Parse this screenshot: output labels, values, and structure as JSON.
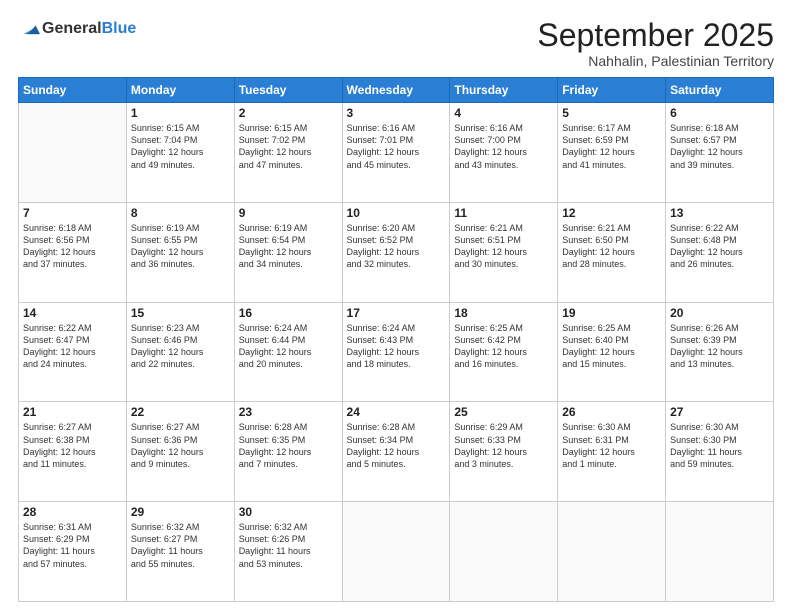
{
  "logo": {
    "general": "General",
    "blue": "Blue"
  },
  "header": {
    "month": "September 2025",
    "location": "Nahhalin, Palestinian Territory"
  },
  "weekdays": [
    "Sunday",
    "Monday",
    "Tuesday",
    "Wednesday",
    "Thursday",
    "Friday",
    "Saturday"
  ],
  "weeks": [
    [
      {
        "day": "",
        "content": ""
      },
      {
        "day": "1",
        "content": "Sunrise: 6:15 AM\nSunset: 7:04 PM\nDaylight: 12 hours\nand 49 minutes."
      },
      {
        "day": "2",
        "content": "Sunrise: 6:15 AM\nSunset: 7:02 PM\nDaylight: 12 hours\nand 47 minutes."
      },
      {
        "day": "3",
        "content": "Sunrise: 6:16 AM\nSunset: 7:01 PM\nDaylight: 12 hours\nand 45 minutes."
      },
      {
        "day": "4",
        "content": "Sunrise: 6:16 AM\nSunset: 7:00 PM\nDaylight: 12 hours\nand 43 minutes."
      },
      {
        "day": "5",
        "content": "Sunrise: 6:17 AM\nSunset: 6:59 PM\nDaylight: 12 hours\nand 41 minutes."
      },
      {
        "day": "6",
        "content": "Sunrise: 6:18 AM\nSunset: 6:57 PM\nDaylight: 12 hours\nand 39 minutes."
      }
    ],
    [
      {
        "day": "7",
        "content": "Sunrise: 6:18 AM\nSunset: 6:56 PM\nDaylight: 12 hours\nand 37 minutes."
      },
      {
        "day": "8",
        "content": "Sunrise: 6:19 AM\nSunset: 6:55 PM\nDaylight: 12 hours\nand 36 minutes."
      },
      {
        "day": "9",
        "content": "Sunrise: 6:19 AM\nSunset: 6:54 PM\nDaylight: 12 hours\nand 34 minutes."
      },
      {
        "day": "10",
        "content": "Sunrise: 6:20 AM\nSunset: 6:52 PM\nDaylight: 12 hours\nand 32 minutes."
      },
      {
        "day": "11",
        "content": "Sunrise: 6:21 AM\nSunset: 6:51 PM\nDaylight: 12 hours\nand 30 minutes."
      },
      {
        "day": "12",
        "content": "Sunrise: 6:21 AM\nSunset: 6:50 PM\nDaylight: 12 hours\nand 28 minutes."
      },
      {
        "day": "13",
        "content": "Sunrise: 6:22 AM\nSunset: 6:48 PM\nDaylight: 12 hours\nand 26 minutes."
      }
    ],
    [
      {
        "day": "14",
        "content": "Sunrise: 6:22 AM\nSunset: 6:47 PM\nDaylight: 12 hours\nand 24 minutes."
      },
      {
        "day": "15",
        "content": "Sunrise: 6:23 AM\nSunset: 6:46 PM\nDaylight: 12 hours\nand 22 minutes."
      },
      {
        "day": "16",
        "content": "Sunrise: 6:24 AM\nSunset: 6:44 PM\nDaylight: 12 hours\nand 20 minutes."
      },
      {
        "day": "17",
        "content": "Sunrise: 6:24 AM\nSunset: 6:43 PM\nDaylight: 12 hours\nand 18 minutes."
      },
      {
        "day": "18",
        "content": "Sunrise: 6:25 AM\nSunset: 6:42 PM\nDaylight: 12 hours\nand 16 minutes."
      },
      {
        "day": "19",
        "content": "Sunrise: 6:25 AM\nSunset: 6:40 PM\nDaylight: 12 hours\nand 15 minutes."
      },
      {
        "day": "20",
        "content": "Sunrise: 6:26 AM\nSunset: 6:39 PM\nDaylight: 12 hours\nand 13 minutes."
      }
    ],
    [
      {
        "day": "21",
        "content": "Sunrise: 6:27 AM\nSunset: 6:38 PM\nDaylight: 12 hours\nand 11 minutes."
      },
      {
        "day": "22",
        "content": "Sunrise: 6:27 AM\nSunset: 6:36 PM\nDaylight: 12 hours\nand 9 minutes."
      },
      {
        "day": "23",
        "content": "Sunrise: 6:28 AM\nSunset: 6:35 PM\nDaylight: 12 hours\nand 7 minutes."
      },
      {
        "day": "24",
        "content": "Sunrise: 6:28 AM\nSunset: 6:34 PM\nDaylight: 12 hours\nand 5 minutes."
      },
      {
        "day": "25",
        "content": "Sunrise: 6:29 AM\nSunset: 6:33 PM\nDaylight: 12 hours\nand 3 minutes."
      },
      {
        "day": "26",
        "content": "Sunrise: 6:30 AM\nSunset: 6:31 PM\nDaylight: 12 hours\nand 1 minute."
      },
      {
        "day": "27",
        "content": "Sunrise: 6:30 AM\nSunset: 6:30 PM\nDaylight: 11 hours\nand 59 minutes."
      }
    ],
    [
      {
        "day": "28",
        "content": "Sunrise: 6:31 AM\nSunset: 6:29 PM\nDaylight: 11 hours\nand 57 minutes."
      },
      {
        "day": "29",
        "content": "Sunrise: 6:32 AM\nSunset: 6:27 PM\nDaylight: 11 hours\nand 55 minutes."
      },
      {
        "day": "30",
        "content": "Sunrise: 6:32 AM\nSunset: 6:26 PM\nDaylight: 11 hours\nand 53 minutes."
      },
      {
        "day": "",
        "content": ""
      },
      {
        "day": "",
        "content": ""
      },
      {
        "day": "",
        "content": ""
      },
      {
        "day": "",
        "content": ""
      }
    ]
  ]
}
